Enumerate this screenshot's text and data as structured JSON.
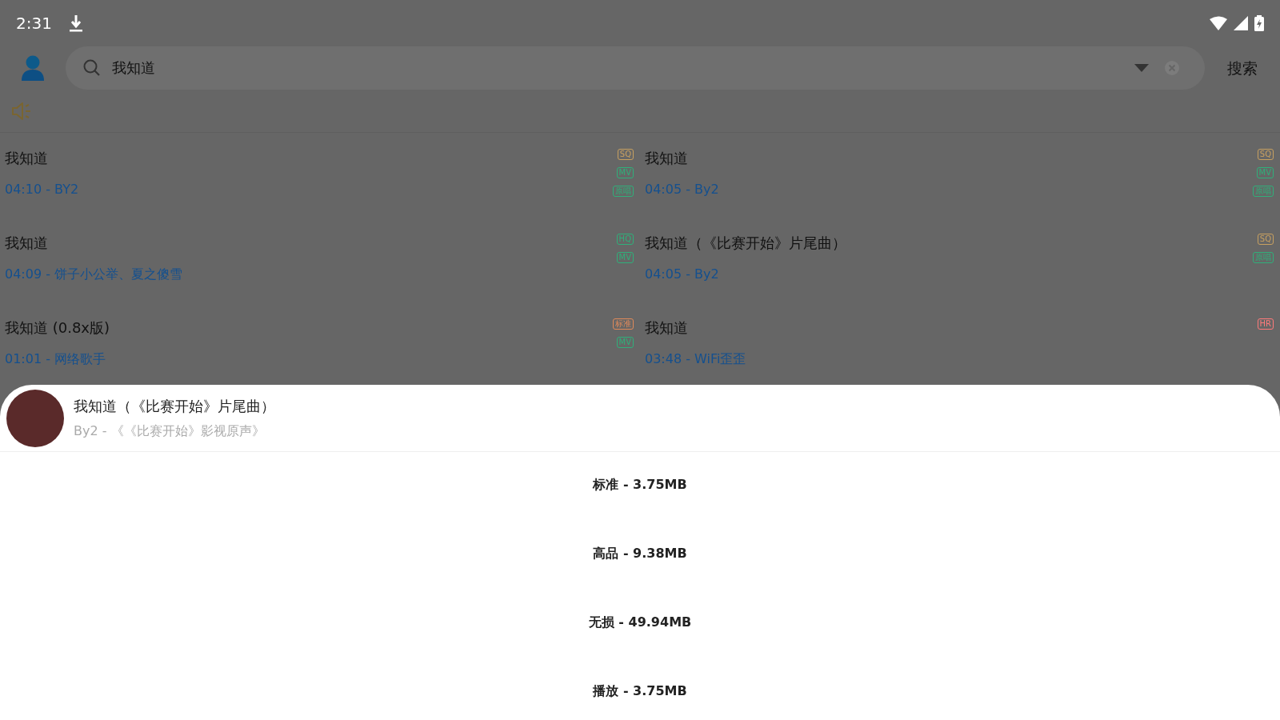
{
  "status_bar": {
    "time": "2:31"
  },
  "search": {
    "value": "我知道",
    "button": "搜索"
  },
  "songs": [
    {
      "title": "我知道",
      "info": "04:10 - BY2",
      "badges": [
        {
          "text": "SQ",
          "color": "#c8a060"
        },
        {
          "text": "MV",
          "color": "#2fb07a"
        },
        {
          "text": "原唱",
          "color": "#2fb07a"
        }
      ]
    },
    {
      "title": "我知道",
      "info": "04:05 - By2",
      "badges": [
        {
          "text": "SQ",
          "color": "#c8a060"
        },
        {
          "text": "MV",
          "color": "#2fb07a"
        },
        {
          "text": "原唱",
          "color": "#2fb07a"
        }
      ]
    },
    {
      "title": "我知道",
      "info": "04:09 - 饼子小公举、夏之傻雪",
      "badges": [
        {
          "text": "HQ",
          "color": "#2fb07a"
        },
        {
          "text": "MV",
          "color": "#2fb07a"
        }
      ]
    },
    {
      "title": "我知道（《比赛开始》片尾曲）",
      "info": "04:05 - By2",
      "badges": [
        {
          "text": "SQ",
          "color": "#c8a060"
        },
        {
          "text": "原唱",
          "color": "#2fb07a"
        }
      ]
    },
    {
      "title": "我知道 (0.8x版)",
      "info": "01:01 - 网络歌手",
      "badges": [
        {
          "text": "标准",
          "color": "#e08a5a"
        },
        {
          "text": "MV",
          "color": "#2fb07a"
        }
      ]
    },
    {
      "title": "我知道",
      "info": "03:48 - WiFi歪歪",
      "badges": [
        {
          "text": "HR",
          "color": "#ff7a7a"
        }
      ]
    }
  ],
  "sheet": {
    "title": "我知道（《比赛开始》片尾曲）",
    "subtitle": "By2 - 《《比赛开始》影视原声》",
    "options": [
      "标准 - 3.75MB",
      "高品 - 9.38MB",
      "无损 - 49.94MB",
      "播放 - 3.75MB"
    ]
  }
}
